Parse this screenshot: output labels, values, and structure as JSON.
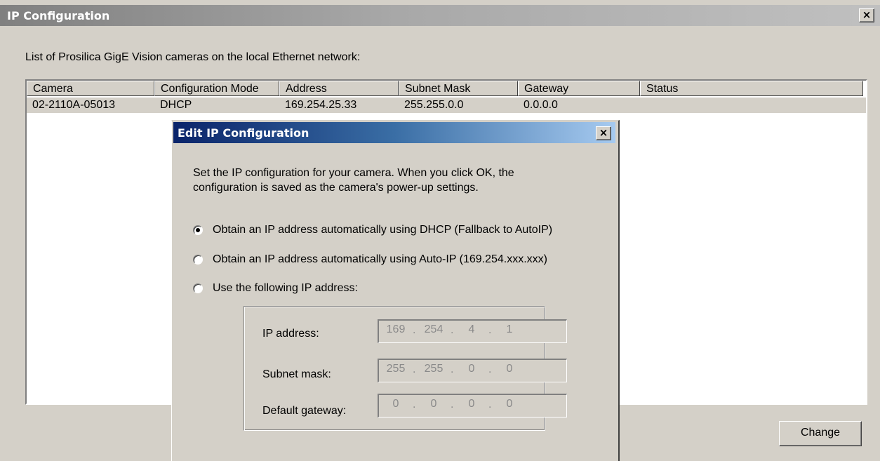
{
  "window": {
    "title": "IP Configuration",
    "close_symbol": "×"
  },
  "intro_text": "List of Prosilica GigE Vision cameras on the local Ethernet network:",
  "table": {
    "columns": [
      "Camera",
      "Configuration Mode",
      "Address",
      "Subnet Mask",
      "Gateway",
      "Status"
    ],
    "rows": [
      [
        "02-2110A-05013",
        "DHCP",
        "169.254.25.33",
        "255.255.0.0",
        "0.0.0.0",
        ""
      ]
    ]
  },
  "change_button_label": "Change",
  "dialog": {
    "title": "Edit IP Configuration",
    "close_symbol": "×",
    "description_line1": "Set the IP configuration for your camera.  When you click OK, the",
    "description_line2": "configuration is saved as the camera's power-up settings.",
    "options": [
      {
        "label": "Obtain an IP address automatically using DHCP (Fallback to AutoIP)",
        "selected": true
      },
      {
        "label": "Obtain an IP address automatically using Auto-IP (169.254.xxx.xxx)",
        "selected": false
      },
      {
        "label": "Use the following IP address:",
        "selected": false
      }
    ],
    "fields": [
      {
        "label": "IP address:",
        "octets": [
          "169",
          "254",
          "4",
          "1"
        ],
        "enabled": false
      },
      {
        "label": "Subnet mask:",
        "octets": [
          "255",
          "255",
          "0",
          "0"
        ],
        "enabled": false
      },
      {
        "label": "Default gateway:",
        "octets": [
          "0",
          "0",
          "0",
          "0"
        ],
        "enabled": false
      }
    ],
    "octet_separator": "."
  },
  "colors": {
    "window_bg": "#d4d0c8",
    "active_title_start": "#0a246a",
    "active_title_end": "#a6caf0",
    "inactive_title": "#808080",
    "disabled_text": "#8a8a8a"
  }
}
